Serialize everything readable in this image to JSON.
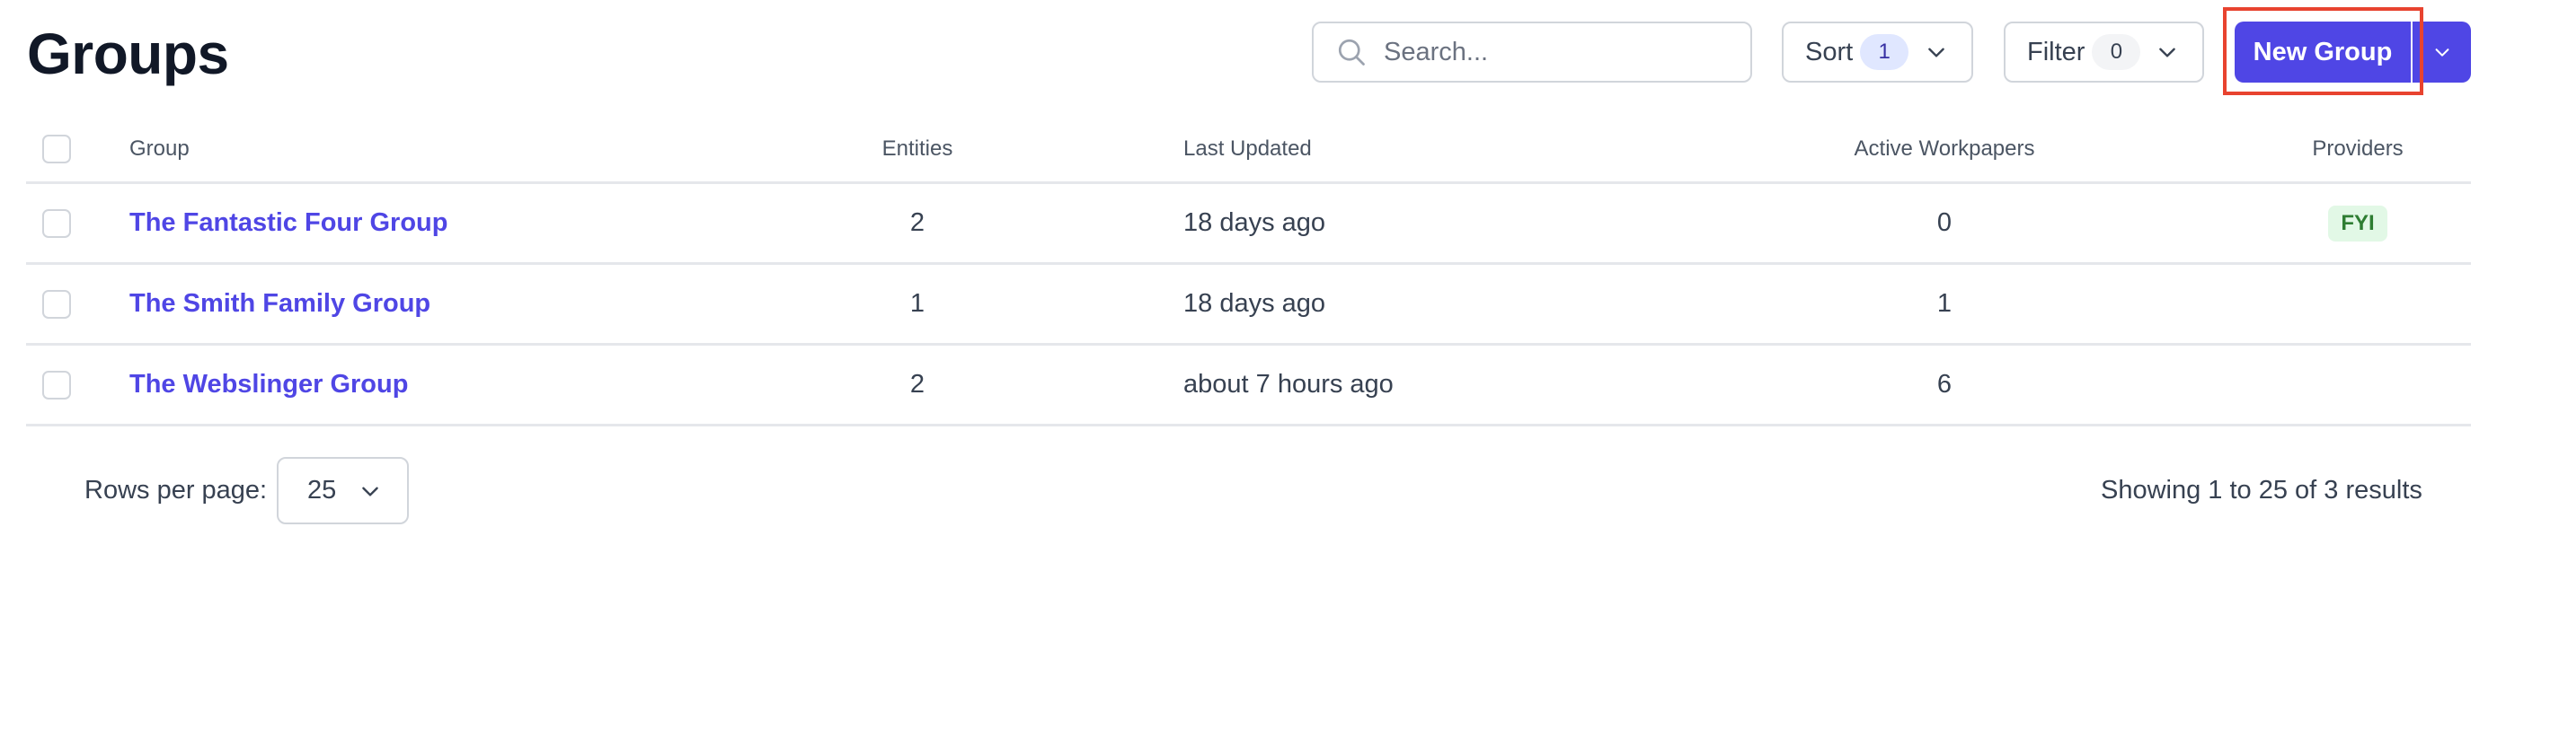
{
  "page": {
    "title": "Groups"
  },
  "toolbar": {
    "search_placeholder": "Search...",
    "search_value": "",
    "sort_label": "Sort",
    "sort_count": "1",
    "filter_label": "Filter",
    "filter_count": "0",
    "new_group_label": "New Group"
  },
  "table": {
    "columns": [
      "Group",
      "Entities",
      "Last Updated",
      "Active Workpapers",
      "Providers"
    ],
    "rows": [
      {
        "group": "The Fantastic Four Group",
        "entities": "2",
        "last_updated": "18 days ago",
        "active_workpapers": "0",
        "providers": "FYI"
      },
      {
        "group": "The Smith Family Group",
        "entities": "1",
        "last_updated": "18 days ago",
        "active_workpapers": "1",
        "providers": ""
      },
      {
        "group": "The Webslinger Group",
        "entities": "2",
        "last_updated": "about 7 hours ago",
        "active_workpapers": "6",
        "providers": ""
      }
    ]
  },
  "pagination": {
    "rows_per_page_label": "Rows per page:",
    "rows_per_page_value": "25",
    "summary": "Showing 1 to 25 of 3 results"
  },
  "colors": {
    "primary": "#4f46e5",
    "highlight": "#e8432f",
    "provider_badge_bg": "#e2f8e6",
    "provider_badge_text": "#2e7d32"
  }
}
